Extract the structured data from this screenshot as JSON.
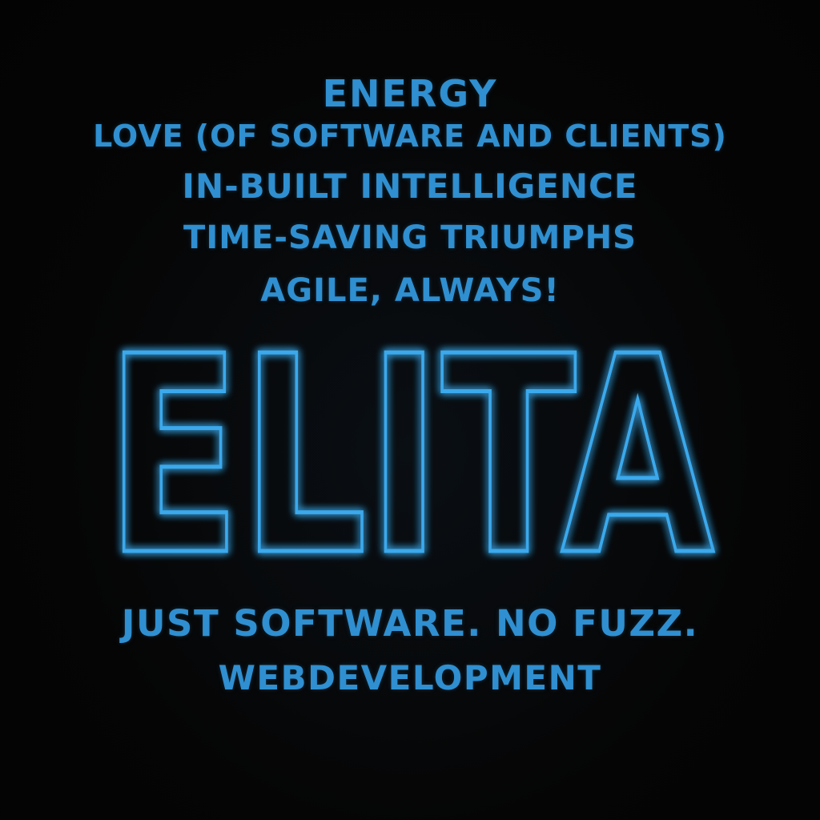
{
  "lines": {
    "energy": "ENERGY",
    "love": "LOVE (OF SOFTWARE AND CLIENTS)",
    "intelligence": "IN-BUILT INTELLIGENCE",
    "time": "TIME-SAVING TRIUMPHS",
    "agile": "AGILE, ALWAYS!"
  },
  "logo": {
    "text": "ELITA"
  },
  "tagline": "JUST SOFTWARE. NO FUZZ.",
  "service": "WEBDEVELOPMENT",
  "colors": {
    "background": "#050505",
    "text": "#2f8fd0",
    "neon": "#3aa9ec"
  }
}
